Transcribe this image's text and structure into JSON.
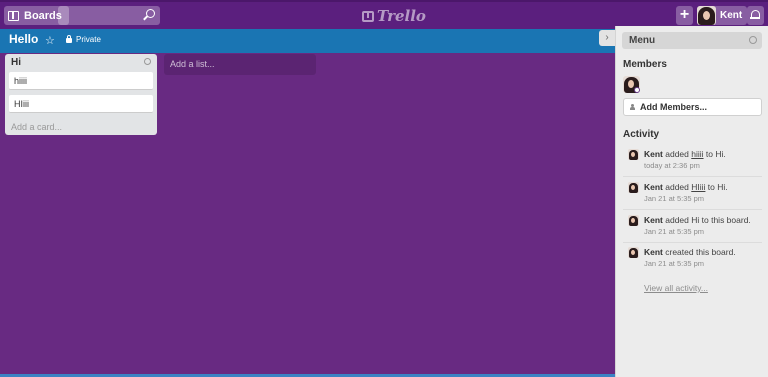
{
  "header": {
    "boards_label": "Boards",
    "search_placeholder": "",
    "logo_text": "Trello",
    "add_label": "+",
    "user_name": "Kent"
  },
  "board": {
    "title": "Hello",
    "visibility": "Private"
  },
  "lists": [
    {
      "title": "Hi",
      "cards": [
        "hiiii",
        "HIiii"
      ],
      "add_card_label": "Add a card..."
    }
  ],
  "add_list_label": "Add a list...",
  "sidebar": {
    "menu_label": "Menu",
    "members_title": "Members",
    "add_members_label": "Add Members...",
    "activity_title": "Activity",
    "activity": [
      {
        "user": "Kent",
        "pre": " added ",
        "link": "hiiii",
        "post": " to Hi.",
        "time": "today at 2:36 pm"
      },
      {
        "user": "Kent",
        "pre": " added ",
        "link": "HIiii",
        "post": " to Hi.",
        "time": "Jan 21 at 5:35 pm"
      },
      {
        "user": "Kent",
        "pre": " added Hi to this board.",
        "link": "",
        "post": "",
        "time": "Jan 21 at 5:35 pm"
      },
      {
        "user": "Kent",
        "pre": " created this board.",
        "link": "",
        "post": "",
        "time": "Jan 21 at 5:35 pm"
      }
    ],
    "view_all_label": "View all activity..."
  },
  "colors": {
    "board_background": "#682a82",
    "header_background": "#5b1f7e",
    "board_bar": "#1a75b3",
    "sidebar_background": "#ececec"
  }
}
